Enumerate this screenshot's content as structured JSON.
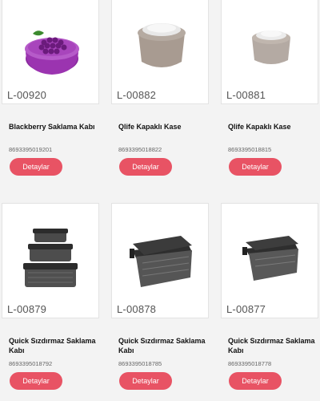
{
  "products": [
    {
      "code": "L-00920",
      "name": "Blackberry Saklama Kabı",
      "barcode": "8693395019201",
      "button": "Detaylar"
    },
    {
      "code": "L-00882",
      "name": "Qlife Kapaklı Kase",
      "barcode": "8693395018822",
      "button": "Detaylar"
    },
    {
      "code": "L-00881",
      "name": "Qlife Kapaklı Kase",
      "barcode": "8693395018815",
      "button": "Detaylar"
    },
    {
      "code": "L-00879",
      "name": "Quick Sızdırmaz Saklama Kabı",
      "barcode": "8693395018792",
      "button": "Detaylar"
    },
    {
      "code": "L-00878",
      "name": "Quick Sızdırmaz Saklama Kabı",
      "barcode": "8693395018785",
      "button": "Detaylar"
    },
    {
      "code": "L-00877",
      "name": "Quick Sızdırmaz Saklama Kabı",
      "barcode": "8693395018778",
      "button": "Detaylar"
    }
  ],
  "colors": {
    "accent": "#e85364",
    "background": "#f3f3f3"
  }
}
